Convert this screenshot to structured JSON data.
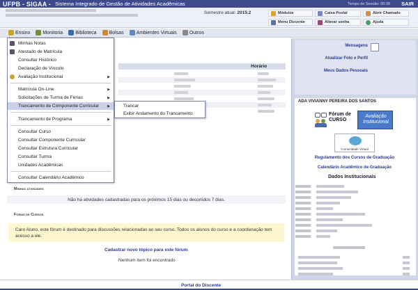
{
  "topbar": {
    "brand": "UFPB - SIGAA -",
    "system_name": "Sistema Integrado de Gestão de Atividades Acadêmicas",
    "session_time": "Tempo de Sessão: 00:30",
    "sair": "SAIR"
  },
  "header": {
    "semestre_label": "Semestre atual:",
    "semestre_value": "2015.2",
    "quick": [
      {
        "label": "Módulos",
        "icon": "modules-icon",
        "color": "#e3a128"
      },
      {
        "label": "Caixa Postal",
        "icon": "mail-icon",
        "color": "#7a86b8"
      },
      {
        "label": "Abrir Chamado",
        "icon": "ticket-icon",
        "color": "#d9894a"
      },
      {
        "label": "Menu Discente",
        "icon": "menu-icon",
        "color": "#5a6fb0"
      },
      {
        "label": "Alterar senha",
        "icon": "password-icon",
        "color": "#9a4a7a"
      },
      {
        "label": "Ajuda",
        "icon": "help-icon",
        "color": "#4a9a6a"
      }
    ]
  },
  "menubar": {
    "items": [
      {
        "label": "Ensino",
        "icon": "ensino-icon",
        "color": "#c9a52a"
      },
      {
        "label": "Monitoria",
        "icon": "monitoria-icon",
        "color": "#7a8a3a"
      },
      {
        "label": "Biblioteca",
        "icon": "biblioteca-icon",
        "color": "#3a6ab0"
      },
      {
        "label": "Bolsas",
        "icon": "bolsas-icon",
        "color": "#c98a3a"
      },
      {
        "label": "Ambientes Virtuais",
        "icon": "ambientes-icon",
        "color": "#5a8ac0"
      },
      {
        "label": "Outros",
        "icon": "outros-icon",
        "color": "#8a8a8a"
      }
    ]
  },
  "dropdown": {
    "items": [
      {
        "label": "Minhas Notas",
        "icon": "notes-icon",
        "arrow": ""
      },
      {
        "label": "Atestado de Matrícula",
        "icon": "document-icon",
        "arrow": ""
      },
      {
        "label": "Consultar Histórico",
        "icon": "",
        "arrow": ""
      },
      {
        "label": "Declaração de Vínculo",
        "icon": "",
        "arrow": ""
      },
      {
        "label": "Avaliação Institucional",
        "icon": "evaluation-icon",
        "arrow": "▶"
      },
      {
        "label": "Matrícula On-Line",
        "icon": "",
        "arrow": "▶"
      },
      {
        "label": "Solicitações de Turma de Férias",
        "icon": "",
        "arrow": "▶"
      },
      {
        "label": "Trancamento de Componente Curricular",
        "icon": "",
        "arrow": "▶"
      },
      {
        "label": "Trancamento de Programa",
        "icon": "",
        "arrow": "▶"
      },
      {
        "label": "Consultar Curso",
        "icon": "",
        "arrow": ""
      },
      {
        "label": "Consultar Componente Curricular",
        "icon": "",
        "arrow": ""
      },
      {
        "label": "Consultar Estrutura Curricular",
        "icon": "",
        "arrow": ""
      },
      {
        "label": "Consultar Turma",
        "icon": "",
        "arrow": ""
      },
      {
        "label": "Unidades Acadêmicas",
        "icon": "",
        "arrow": ""
      },
      {
        "label": "Consultar Calendário Acadêmico",
        "icon": "",
        "arrow": ""
      }
    ],
    "submenu": [
      "Trancar",
      "Exibir Andamento do Trancamento"
    ]
  },
  "main": {
    "table_header": "Horário",
    "atividades_title": "Minhas atividades",
    "atividades_msg": "Não há atividades cadastradas para os próximos 15 dias ou decorridos 7 dias.",
    "forum_title": "Fórum de Cursos",
    "forum_msg": "Caro Aluno, este fórum é destinado para discussões relacionadas ao seu curso. Todos os alunos do curso e a coordenação tem acesso a ele.",
    "forum_new_topic": "Cadastrar novo tópico para este fórum",
    "forum_empty": "Nenhum item foi encontrado"
  },
  "right_panel": {
    "mensagens": "Mensagens",
    "atualizar_foto": "Atualizar Foto e Perfil",
    "meus_dados": "Meus Dados Pessoais",
    "student_name": "ADA VIVIANNY PEREIRA DOS SANTOS",
    "forum_curso": "Fórum de CURSO",
    "avaliacao": "Avaliação Institucional",
    "comunidade": "Comunidade Virtual",
    "regulamento": "Regulamento dos Cursos de Graduação",
    "calendario": "Calendário Acadêmico de Graduação",
    "dados_title": "Dados Institucionais"
  },
  "footer": {
    "portal": "Portal do Discente"
  }
}
